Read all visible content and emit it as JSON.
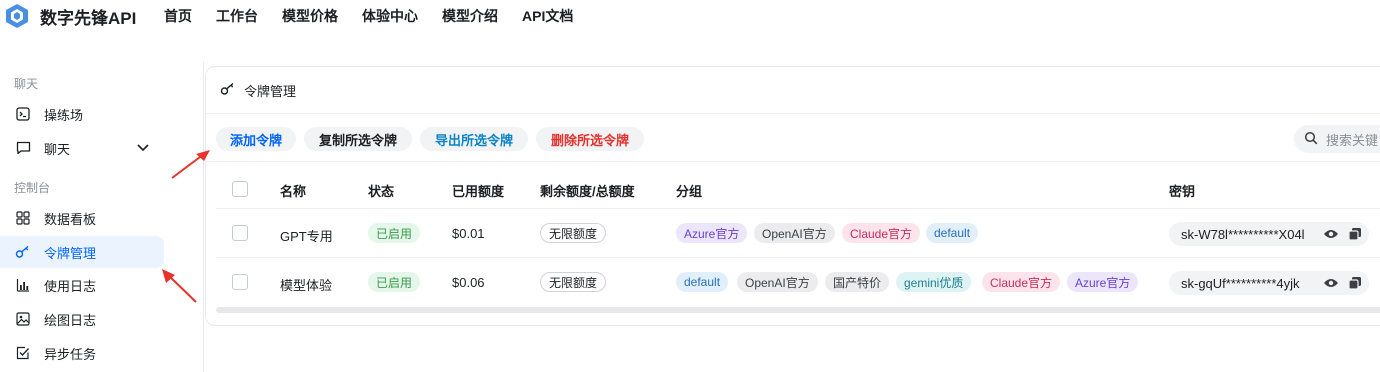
{
  "header": {
    "brand": "数字先锋API",
    "nav": [
      "首页",
      "工作台",
      "模型价格",
      "体验中心",
      "模型介绍",
      "API文档"
    ]
  },
  "sidebar": {
    "group_chat": "聊天",
    "group_console": "控制台",
    "items": [
      {
        "label": "操练场",
        "icon": "terminal-icon"
      },
      {
        "label": "聊天",
        "icon": "chat-bubble-icon"
      },
      {
        "label": "数据看板",
        "icon": "dashboard-grid-icon"
      },
      {
        "label": "令牌管理",
        "icon": "key-icon",
        "active": true
      },
      {
        "label": "使用日志",
        "icon": "bar-chart-icon"
      },
      {
        "label": "绘图日志",
        "icon": "image-icon"
      },
      {
        "label": "异步任务",
        "icon": "checkbox-task-icon"
      }
    ]
  },
  "card": {
    "title": "令牌管理",
    "buttons": {
      "add": "添加令牌",
      "copy": "复制所选令牌",
      "export": "导出所选令牌",
      "delete": "删除所选令牌"
    },
    "search_placeholder": "搜索关键"
  },
  "table": {
    "headers": [
      "名称",
      "状态",
      "已用额度",
      "剩余额度/总额度",
      "分组",
      "密钥"
    ],
    "rows": [
      {
        "name": "GPT专用",
        "status": "已启用",
        "used": "$0.01",
        "quota": "无限额度",
        "groups": [
          "Azure官方",
          "OpenAI官方",
          "Claude官方",
          "default"
        ],
        "key": "sk-W78l**********X04l"
      },
      {
        "name": "模型体验",
        "status": "已启用",
        "used": "$0.06",
        "quota": "无限额度",
        "groups": [
          "default",
          "OpenAI官方",
          "国产特价",
          "gemini优质",
          "Claude官方",
          "Azure官方"
        ],
        "key": "sk-gqUf**********4yjk"
      }
    ]
  },
  "colors": {
    "accent": "#0064fa",
    "export": "#0a84c6",
    "danger": "#e5322d",
    "arrow": "#e8322a"
  }
}
